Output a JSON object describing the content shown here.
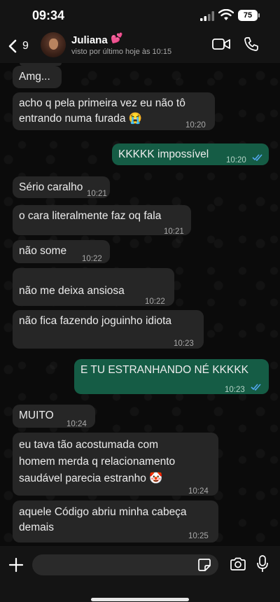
{
  "status_bar": {
    "time": "09:34",
    "battery": "75"
  },
  "header": {
    "back_count": "9",
    "contact_name": "Juliana",
    "contact_emoji": "💕",
    "last_seen": "visto por último hoje às 10:15"
  },
  "messages": [
    {
      "direction": "in",
      "text": "Amg...",
      "time": ""
    },
    {
      "direction": "in",
      "text": "acho q pela primeira vez eu não tô\nentrando numa furada 😭",
      "time": "10:20"
    },
    {
      "direction": "out",
      "text": "KKKKK impossível",
      "time": "10:20"
    },
    {
      "direction": "in",
      "text": "Sério caralho",
      "time": "10:21"
    },
    {
      "direction": "in",
      "text": "o cara literalmente faz oq fala",
      "time": "10:21"
    },
    {
      "direction": "in",
      "text": "não some",
      "time": "10:22"
    },
    {
      "direction": "in",
      "text": "não me deixa ansiosa",
      "time": "10:22"
    },
    {
      "direction": "in",
      "text": "não fica fazendo joguinho idiota",
      "time": "10:23"
    },
    {
      "direction": "out",
      "text": "E TU ESTRANHANDO NÉ KKKKK",
      "time": "10:23"
    },
    {
      "direction": "in",
      "text": "MUITO",
      "time": "10:24"
    },
    {
      "direction": "in",
      "text": "eu tava tão acostumada com\nhomem merda q relacionamento\nsaudável parecia estranho 🤡",
      "time": "10:24"
    },
    {
      "direction": "in",
      "text": "aquele Código abriu minha cabeça\ndemais",
      "time": "10:25"
    }
  ],
  "input": {
    "placeholder": ""
  },
  "colors": {
    "incoming_bubble": "#262626",
    "outgoing_bubble": "#155c45",
    "read_ticks": "#53a8f0",
    "background": "#0b0b0b"
  },
  "icons": [
    "back-chevron-icon",
    "video-call-icon",
    "phone-icon",
    "plus-icon",
    "sticker-icon",
    "camera-icon",
    "microphone-icon",
    "read-receipt-icon",
    "signal-icon",
    "wifi-icon"
  ]
}
